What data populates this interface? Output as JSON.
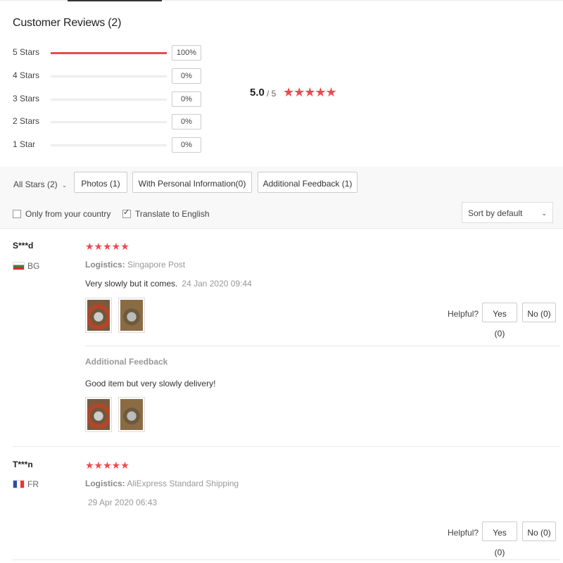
{
  "title": "Customer Reviews (2)",
  "distribution": [
    {
      "label": "5 Stars",
      "percent": 100,
      "percent_label": "100%"
    },
    {
      "label": "4 Stars",
      "percent": 0,
      "percent_label": "0%"
    },
    {
      "label": "3 Stars",
      "percent": 0,
      "percent_label": "0%"
    },
    {
      "label": "2 Stars",
      "percent": 0,
      "percent_label": "0%"
    },
    {
      "label": "1 Star",
      "percent": 0,
      "percent_label": "0%"
    }
  ],
  "rating": {
    "score": "5.0",
    "denominator": "/ 5",
    "stars": "★★★★★"
  },
  "filters": {
    "all_stars": "All Stars (2)",
    "photos": "Photos (1)",
    "personal": "With Personal Information(0)",
    "additional": "Additional Feedback (1)",
    "only_country": "Only from your country",
    "translate": "Translate to English",
    "sort": "Sort by default"
  },
  "reviews": [
    {
      "user": "S***d",
      "country": "BG",
      "stars": "★★★★★",
      "logistics_label": "Logistics:",
      "logistics": "Singapore Post",
      "text": "Very slowly but it comes.",
      "date": "24 Jan 2020 09:44",
      "helpful": "Helpful?",
      "yes": "Yes (0)",
      "no": "No (0)",
      "additional_title": "Additional Feedback",
      "additional_text": "Good item but very slowly delivery!"
    },
    {
      "user": "T***n",
      "country": "FR",
      "stars": "★★★★★",
      "logistics_label": "Logistics:",
      "logistics": "AliExpress Standard Shipping",
      "date": "29 Apr 2020 06:43",
      "helpful": "Helpful?",
      "yes": "Yes (0)",
      "no": "No (0)"
    }
  ],
  "colors": {
    "accent": "#f0484f"
  }
}
